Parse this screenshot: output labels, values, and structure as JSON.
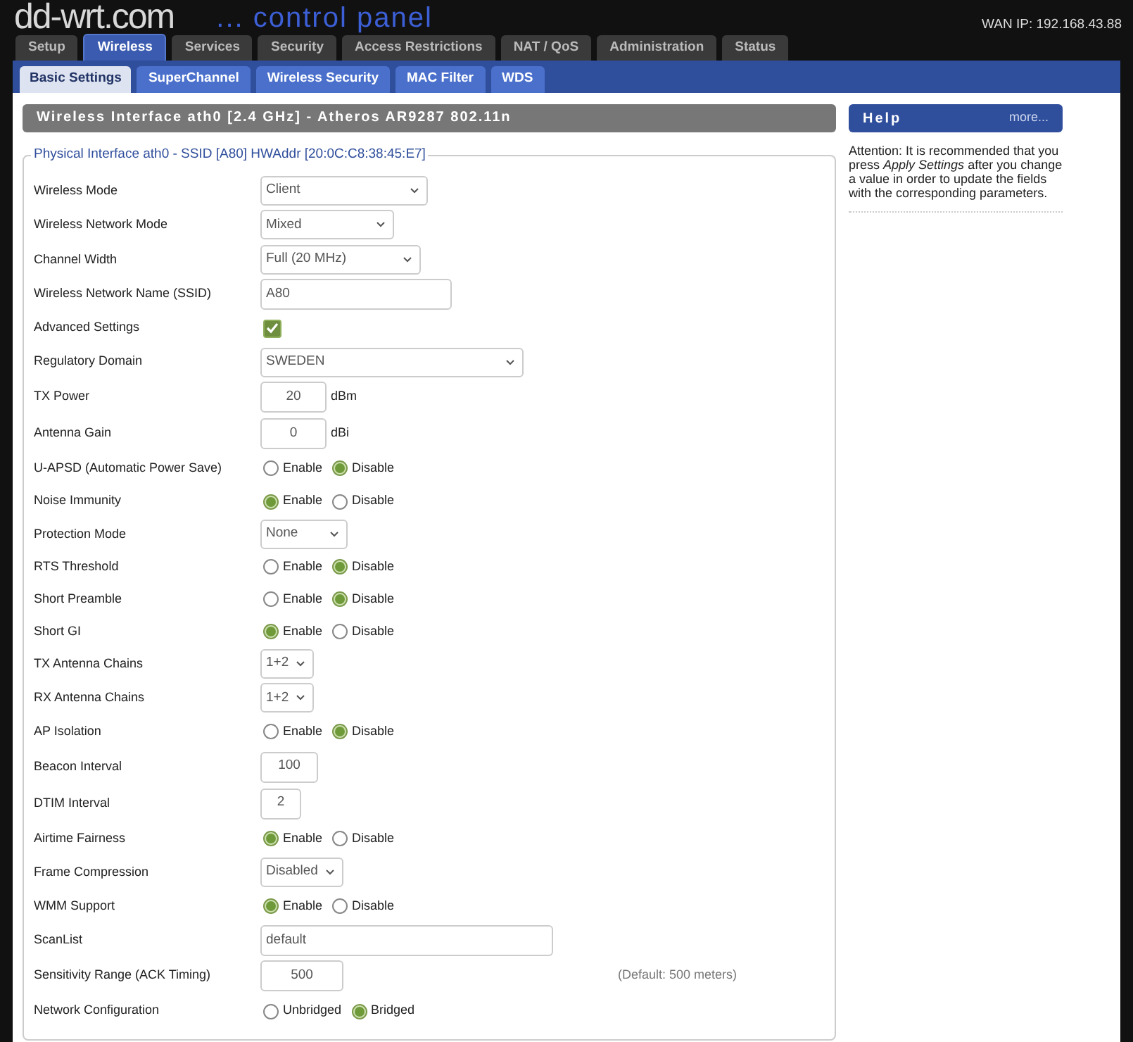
{
  "header": {
    "logo": "dd-wrt.com",
    "tagline": "... control panel",
    "wan_ip": "WAN IP: 192.168.43.88"
  },
  "main_tabs": [
    {
      "label": "Setup",
      "selected": false
    },
    {
      "label": "Wireless",
      "selected": true
    },
    {
      "label": "Services",
      "selected": false
    },
    {
      "label": "Security",
      "selected": false
    },
    {
      "label": "Access Restrictions",
      "selected": false
    },
    {
      "label": "NAT / QoS",
      "selected": false
    },
    {
      "label": "Administration",
      "selected": false
    },
    {
      "label": "Status",
      "selected": false
    }
  ],
  "sub_tabs": [
    {
      "label": "Basic Settings",
      "selected": true
    },
    {
      "label": "SuperChannel",
      "selected": false
    },
    {
      "label": "Wireless Security",
      "selected": false
    },
    {
      "label": "MAC Filter",
      "selected": false
    },
    {
      "label": "WDS",
      "selected": false
    }
  ],
  "section_title": "Wireless Interface ath0 [2.4 GHz] - Atheros AR9287 802.11n",
  "fieldset_legend": "Physical Interface ath0 - SSID [A80] HWAddr [20:0C:C8:38:45:E7]",
  "settings": [
    {
      "kind": "select",
      "label": "Wireless Mode",
      "value": "Client"
    },
    {
      "kind": "select",
      "label": "Wireless Network Mode",
      "value": "Mixed"
    },
    {
      "kind": "select",
      "label": "Channel Width",
      "value": "Full (20 MHz)"
    },
    {
      "kind": "text",
      "label": "Wireless Network Name (SSID)",
      "value": "A80"
    },
    {
      "kind": "checkbox",
      "label": "Advanced Settings",
      "checked": true
    },
    {
      "kind": "select",
      "label": "Regulatory Domain",
      "value": "SWEDEN"
    },
    {
      "kind": "number",
      "label": "TX Power",
      "value": "20",
      "unit": "dBm"
    },
    {
      "kind": "number",
      "label": "Antenna Gain",
      "value": "0",
      "unit": "dBi"
    },
    {
      "kind": "radio",
      "label": "U-APSD (Automatic Power Save)",
      "options": [
        {
          "label": "Enable",
          "selected": false
        },
        {
          "label": "Disable",
          "selected": true
        }
      ]
    },
    {
      "kind": "radio",
      "label": "Noise Immunity",
      "options": [
        {
          "label": "Enable",
          "selected": true
        },
        {
          "label": "Disable",
          "selected": false
        }
      ]
    },
    {
      "kind": "select",
      "label": "Protection Mode",
      "value": "None"
    },
    {
      "kind": "radio",
      "label": "RTS Threshold",
      "options": [
        {
          "label": "Enable",
          "selected": false
        },
        {
          "label": "Disable",
          "selected": true
        }
      ]
    },
    {
      "kind": "radio",
      "label": "Short Preamble",
      "options": [
        {
          "label": "Enable",
          "selected": false
        },
        {
          "label": "Disable",
          "selected": true
        }
      ]
    },
    {
      "kind": "radio",
      "label": "Short GI",
      "options": [
        {
          "label": "Enable",
          "selected": true
        },
        {
          "label": "Disable",
          "selected": false
        }
      ]
    },
    {
      "kind": "select",
      "label": "TX Antenna Chains",
      "value": "1+2"
    },
    {
      "kind": "select",
      "label": "RX Antenna Chains",
      "value": "1+2"
    },
    {
      "kind": "radio",
      "label": "AP Isolation",
      "options": [
        {
          "label": "Enable",
          "selected": false
        },
        {
          "label": "Disable",
          "selected": true
        }
      ]
    },
    {
      "kind": "number",
      "label": "Beacon Interval",
      "value": "100"
    },
    {
      "kind": "number",
      "label": "DTIM Interval",
      "value": "2"
    },
    {
      "kind": "radio",
      "label": "Airtime Fairness",
      "options": [
        {
          "label": "Enable",
          "selected": true
        },
        {
          "label": "Disable",
          "selected": false
        }
      ]
    },
    {
      "kind": "select",
      "label": "Frame Compression",
      "value": "Disabled"
    },
    {
      "kind": "radio",
      "label": "WMM Support",
      "options": [
        {
          "label": "Enable",
          "selected": true
        },
        {
          "label": "Disable",
          "selected": false
        }
      ]
    },
    {
      "kind": "text",
      "label": "ScanList",
      "value": "default"
    },
    {
      "kind": "number",
      "label": "Sensitivity Range (ACK Timing)",
      "value": "500",
      "note": "(Default: 500 meters)"
    },
    {
      "kind": "radio",
      "label": "Network Configuration",
      "options": [
        {
          "label": "Unbridged",
          "selected": false
        },
        {
          "label": "Bridged",
          "selected": true
        }
      ]
    }
  ],
  "help": {
    "title": "Help",
    "more": "more...",
    "text": "Attention: It is recommended that you press *Apply Settings* after you change a value in order to update the fields with the corresponding parameters."
  }
}
